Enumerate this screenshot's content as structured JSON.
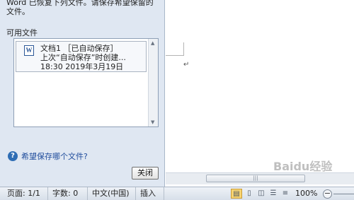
{
  "recovery_pane": {
    "intro_line1": "Word 已恢复下列文件。请保存希望保留的",
    "intro_line2": "文件。",
    "available_label": "可用文件",
    "file_entry": {
      "icon": "word-icon",
      "icon_letter": "W",
      "name": "文档1 ［已自动保存］",
      "description": "上次“自动保存”时创建...",
      "datetime": "18:30 2019年3月19日"
    },
    "help_link": "希望保存哪个文件?",
    "close_button": "关闭"
  },
  "document": {
    "paragraph_mark": "↵",
    "watermark": "Baidu经验"
  },
  "status_bar": {
    "page": "页面: 1/1",
    "words": "字数: 0",
    "language": "中文(中国)",
    "insert_mode": "插入",
    "zoom": "100%",
    "zoom_out": "−",
    "view_buttons": [
      "print-layout-icon",
      "full-screen-reading-icon",
      "web-layout-icon",
      "outline-icon",
      "draft-icon"
    ]
  },
  "colors": {
    "pane_background": "#dfe7f2",
    "active_view": "#f7d471",
    "link": "#1f4c9c"
  }
}
